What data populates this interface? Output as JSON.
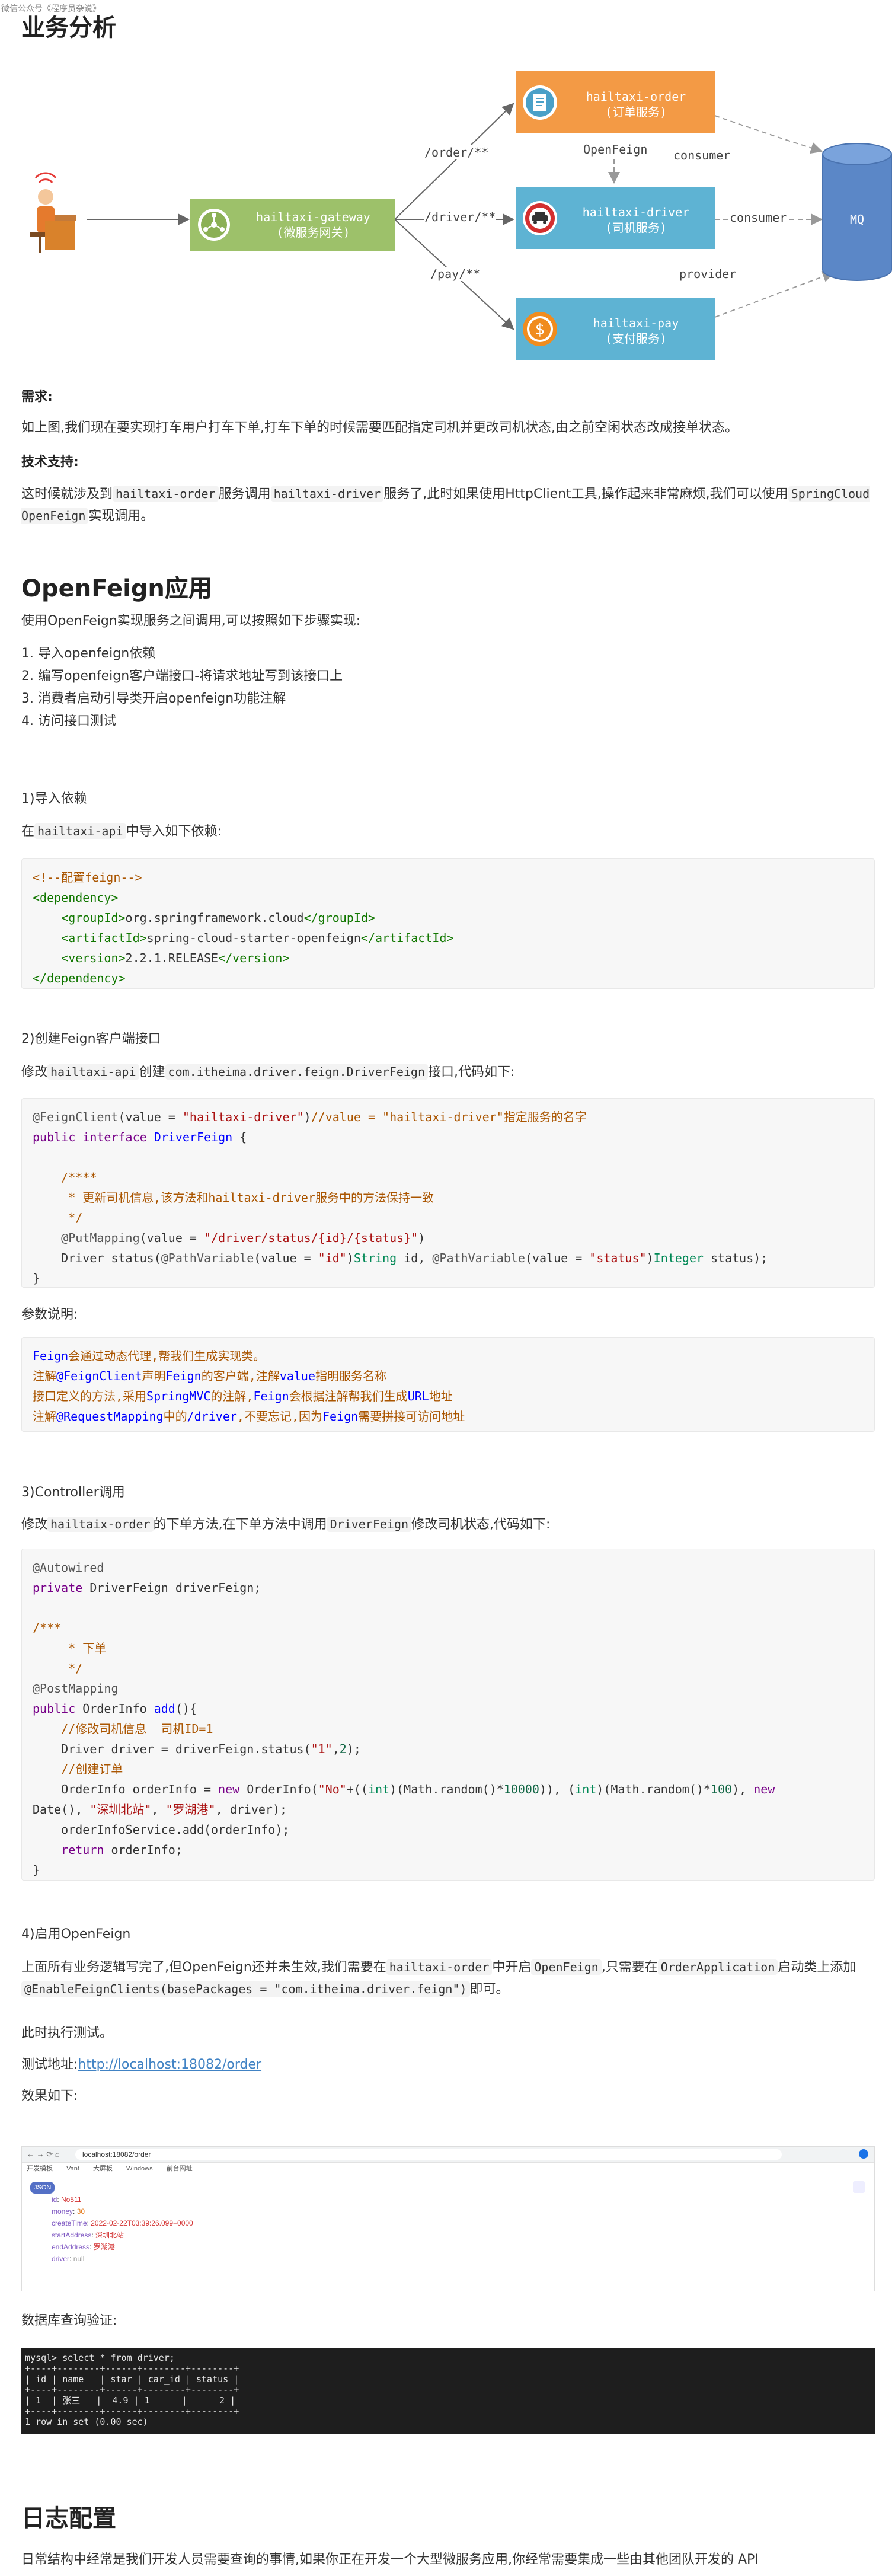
{
  "watermark": "微信公众号《程序员杂说》",
  "section_business": {
    "title": "业务分析",
    "diagram": {
      "gateway": {
        "name": "hailtaxi-gateway",
        "sub": "(微服务网关)"
      },
      "order": {
        "name": "hailtaxi-order",
        "sub": "(订单服务)"
      },
      "driver": {
        "name": "hailtaxi-driver",
        "sub": "(司机服务)"
      },
      "pay": {
        "name": "hailtaxi-pay",
        "sub": "(支付服务)"
      },
      "mq": "MQ",
      "edge_order": "/order/**",
      "edge_driver": "/driver/**",
      "edge_pay": "/pay/**",
      "edge_openfeign": "OpenFeign",
      "edge_consumer1": "consumer",
      "edge_consumer2": "consumer",
      "edge_provider": "provider"
    },
    "need_title": "需求:",
    "need_text": "如上图,我们现在要实现打车用户打车下单,打车下单的时候需要匹配指定司机并更改司机状态,由之前空闲状态改成接单状态。",
    "tech_title": "技术支持:",
    "tech_text_1": "这时候就涉及到",
    "tech_code_1": "hailtaxi-order",
    "tech_text_2": "服务调用",
    "tech_code_2": "hailtaxi-driver",
    "tech_text_3": "服务了,此时如果使用HttpClient工具,操作起来非常麻烦,我们可以使用",
    "tech_code_3": "SpringCloud OpenFeign",
    "tech_text_4": "实现调用。"
  },
  "section_openfeign": {
    "title": "OpenFeign应用",
    "intro": "使用OpenFeign实现服务之间调用,可以按照如下步骤实现:",
    "steps": [
      "导入openfeign依赖",
      "编写openfeign客户端接口-将请求地址写到该接口上",
      "消费者启动引导类开启openfeign功能注解",
      "访问接口测试"
    ],
    "step1_title": "1)导入依赖",
    "step1_text_1": "在",
    "step1_code": "hailtaxi-api",
    "step1_text_2": "中导入如下依赖:",
    "step2_title": "2)创建Feign客户端接口",
    "step2_text_1": "修改",
    "step2_code_1": "hailtaxi-api",
    "step2_text_2": "创建",
    "step2_code_2": "com.itheima.driver.feign.DriverFeign",
    "step2_text_3": "接口,代码如下:",
    "params_title": "参数说明:",
    "step3_title": "3)Controller调用",
    "step3_text_1": "修改",
    "step3_code_1": "hailtaix-order",
    "step3_text_2": "的下单方法,在下单方法中调用",
    "step3_code_2": "DriverFeign",
    "step3_text_3": "修改司机状态,代码如下:",
    "step4_title": "4)启用OpenFeign",
    "step4_text_1": "上面所有业务逻辑写完了,但OpenFeign还并未生效,我们需要在",
    "step4_code_1": "hailtaxi-order",
    "step4_text_2": "中开启",
    "step4_code_2": "OpenFeign",
    "step4_text_3": ",只需要在",
    "step4_code_3": "OrderApplication",
    "step4_text_4": "启动类上添加",
    "step4_code_4": "@EnableFeignClients(basePackages = \"com.itheima.driver.feign\")",
    "step4_text_5": "即可。",
    "run_test": "此时执行测试。",
    "test_addr_label": "测试地址:",
    "test_addr_url": "http://localhost:18082/order",
    "effect_label": "效果如下:",
    "db_label": "数据库查询验证:"
  },
  "browser": {
    "url": "localhost:18082/order",
    "bookmarks": [
      "开发模板",
      "Vant",
      "大屏板",
      "Windows",
      "前台网址"
    ],
    "json_badge": "JSON",
    "fields": [
      {
        "k": "id",
        "v": "No511"
      },
      {
        "k": "money",
        "v": "30"
      },
      {
        "k": "createTime",
        "v": "2022-02-22T03:39:26.099+0000"
      },
      {
        "k": "startAddress",
        "v": "深圳北站"
      },
      {
        "k": "endAddress",
        "v": "罗湖港"
      },
      {
        "k": "driver",
        "v": "null"
      }
    ]
  },
  "terminal": {
    "lines": [
      "mysql> select * from driver;",
      "+----+--------+------+--------+--------+",
      "| id | name   | star | car_id | status |",
      "+----+--------+------+--------+--------+",
      "| 1  | 张三   |  4.9 | 1      |      2 |",
      "+----+--------+------+--------+--------+",
      "1 row in set (0.00 sec)"
    ]
  },
  "section_log": {
    "title": "日志配置",
    "text": "日常结构中经常是我们开发人员需要查询的事情,如果你正在开发一个大型微服务应用,你经常需要集成一些由其他团队开发的 API"
  }
}
